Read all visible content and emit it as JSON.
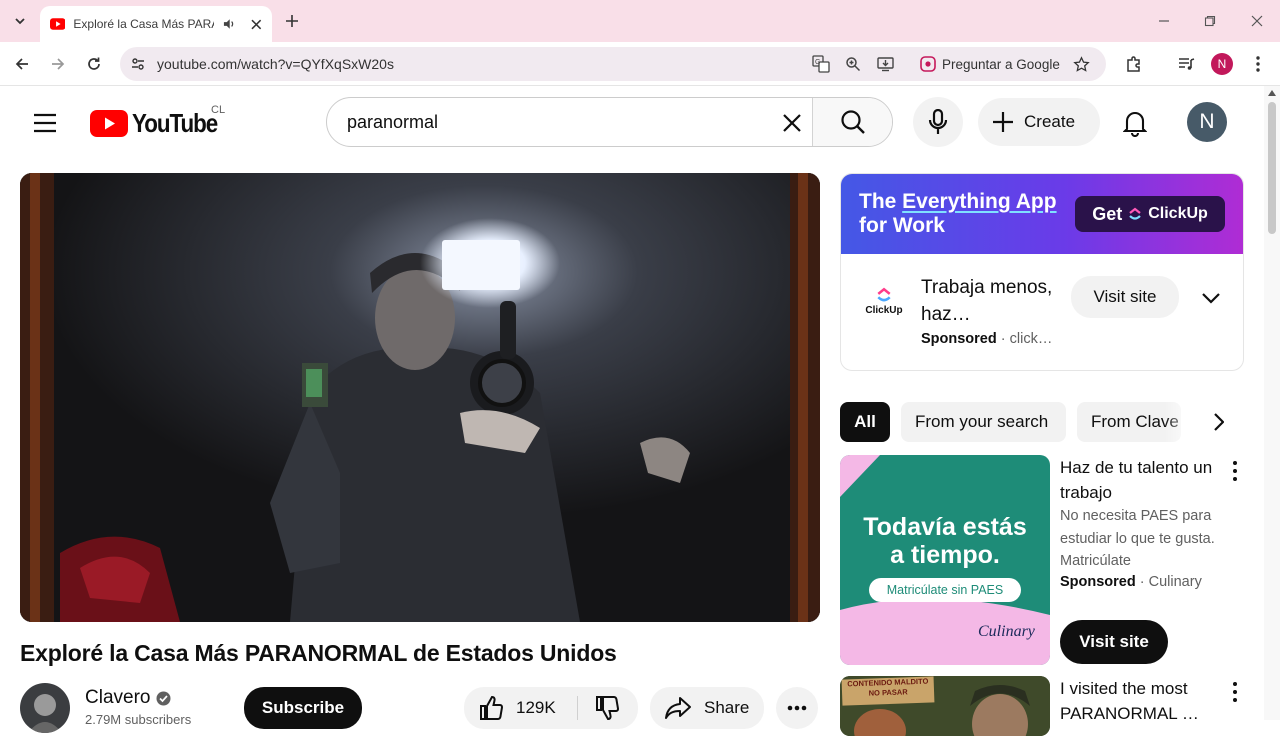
{
  "browser": {
    "tab_title": "Exploré la Casa Más PARANORMAL",
    "url": "youtube.com/watch?v=QYfXqSxW20s",
    "ask_google_label": "Preguntar a Google",
    "profile_initial": "N"
  },
  "header": {
    "logo_text": "YouTube",
    "country_code": "CL",
    "search_value": "paranormal",
    "create_label": "Create",
    "avatar_initial": "N"
  },
  "video": {
    "title": "Exploré la Casa Más PARANORMAL de Estados Unidos",
    "channel_name": "Clavero",
    "subscribers": "2.79M subscribers",
    "subscribe_label": "Subscribe",
    "likes": "129K",
    "share_label": "Share"
  },
  "ad": {
    "banner_line1_a": "The ",
    "banner_line1_b": "Everything App",
    "banner_line2": "for Work",
    "banner_cta_get": "Get",
    "banner_cta_brand": "ClickUp",
    "logo_text": "ClickUp",
    "headline": "Trabaja menos, haz…",
    "sponsored": "Sponsored",
    "source": "click…",
    "visit_label": "Visit site"
  },
  "chips": [
    "All",
    "From your search",
    "From Clave"
  ],
  "recommendations": [
    {
      "title": "Haz de tu talento un trabajo",
      "description": "No necesita PAES para estudiar lo que te gusta. Matricúlate",
      "sponsored": "Sponsored",
      "source": "Culinary",
      "cta": "Visit site",
      "thumb_headline_1": "Todavía estás",
      "thumb_headline_2": "a tiempo.",
      "thumb_pill": "Matricúlate sin PAES",
      "thumb_brand": "Culinary"
    },
    {
      "title": "I visited the most PARANORMAL …",
      "thumb_sign": "CONTENIDO MALDITO NO PASAR"
    }
  ],
  "colors": {
    "tabbar_bg": "#f9dfe8",
    "youtube_red": "#ff0000",
    "ad_gradient_start": "#4458e6",
    "ad_gradient_end": "#b02cd4",
    "culinary_green": "#1e8c78",
    "culinary_pink": "#f4b8e6"
  }
}
